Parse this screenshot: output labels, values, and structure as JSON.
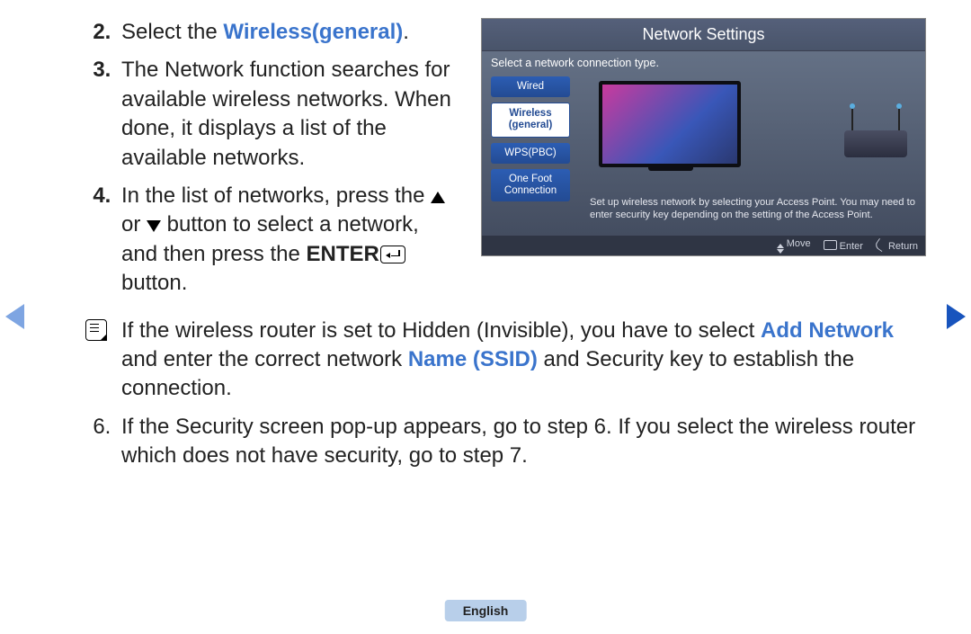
{
  "language": "English",
  "nav": {
    "prev": "Previous page",
    "next": "Next page"
  },
  "steps": {
    "s2_a": "Select the ",
    "s2_link": "Wireless(general)",
    "s2_b": ".",
    "s3": "The Network function searches for available wireless networks. When done, it displays a list of the available networks.",
    "s4_a": "In the list of networks, press the ",
    "s4_or": " or ",
    "s4_b": " button to select a network, and then press the ",
    "s4_enter": "ENTER",
    "s4_c": " button.",
    "note_a": "If the wireless router is set to Hidden (Invisible), you have to select ",
    "note_add": "Add Network",
    "note_b": " and enter the correct network ",
    "note_ssid": "Name (SSID)",
    "note_c": " and Security key to establish the connection.",
    "s5": "If the Security screen pop-up appears, go to step 6. If you select the wireless router which does not have security, go to step 7."
  },
  "panel": {
    "title": "Network Settings",
    "subtitle": "Select a network connection type.",
    "menu": {
      "wired": "Wired",
      "wireless_l1": "Wireless",
      "wireless_l2": "(general)",
      "wps": "WPS(PBC)",
      "onefoot_l1": "One Foot",
      "onefoot_l2": "Connection"
    },
    "desc": "Set up wireless network by selecting your Access Point. You may need to enter security key depending on the setting of the Access Point.",
    "footer": {
      "move": "Move",
      "enter": "Enter",
      "return": "Return"
    }
  }
}
